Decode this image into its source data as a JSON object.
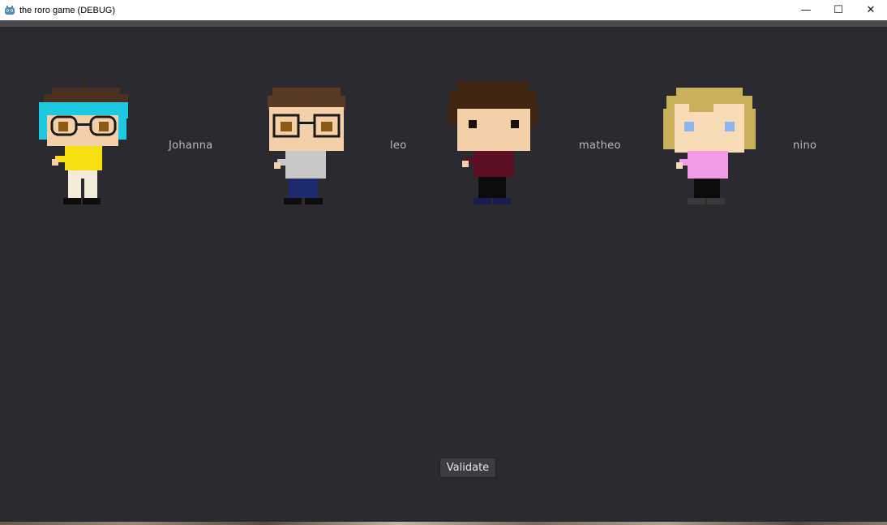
{
  "window": {
    "title": "the roro game (DEBUG)",
    "app_icon": "godot-icon",
    "controls": {
      "minimize": "—",
      "maximize": "☐",
      "close": "✕"
    }
  },
  "characters": [
    {
      "id": "johanna",
      "name": "Johanna",
      "sprite": "pixel-character-cyan-hair-glasses-yellow-shirt"
    },
    {
      "id": "leo",
      "name": "leo",
      "sprite": "pixel-character-brown-hair-glasses-gray-shirt"
    },
    {
      "id": "matheo",
      "name": "matheo",
      "sprite": "pixel-character-brown-hair-maroon-shirt"
    },
    {
      "id": "nino",
      "name": "nino",
      "sprite": "pixel-character-blonde-hair-pink-shirt"
    }
  ],
  "actions": {
    "validate_label": "Validate"
  },
  "colors": {
    "background": "#2b2a31",
    "label_text": "#b8b8bc",
    "button_bg": "#3d3c42"
  }
}
